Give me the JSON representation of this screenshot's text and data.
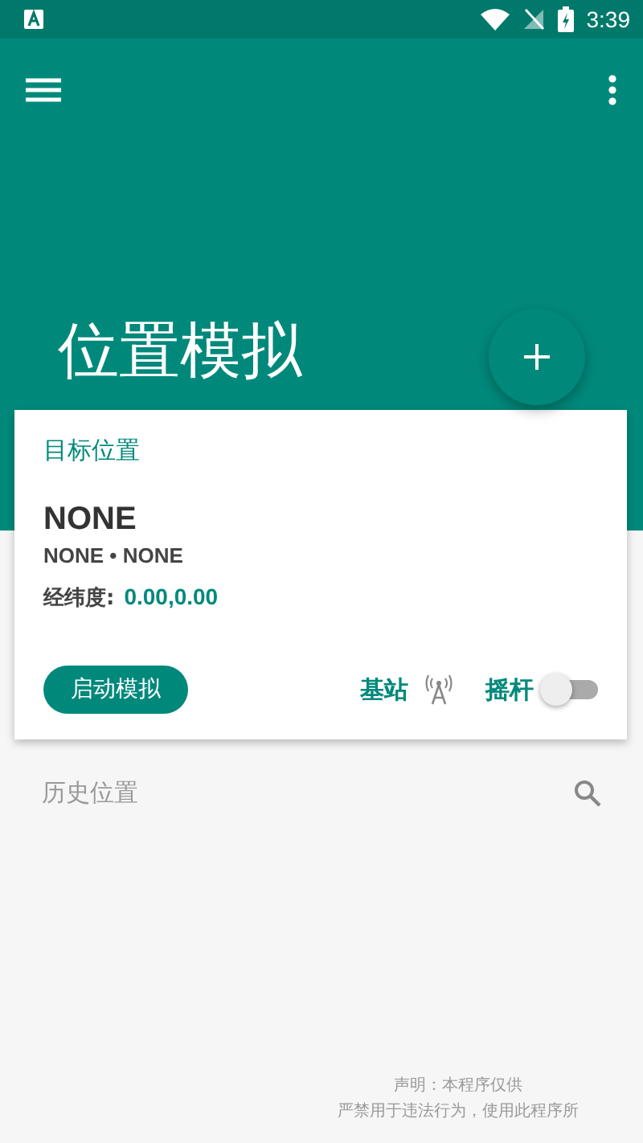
{
  "status_bar": {
    "time": "3:39"
  },
  "header": {
    "title": "位置模拟"
  },
  "target_card": {
    "heading": "目标位置",
    "name": "NONE",
    "region": "NONE • NONE",
    "coords_label": "经纬度:",
    "coords_value": "0.00,0.00",
    "start_button": "启动模拟",
    "base_station": {
      "label": "基站"
    },
    "joystick": {
      "label": "摇杆",
      "on": false
    }
  },
  "history": {
    "title": "历史位置"
  },
  "disclaimer": [
    "声明：本程序仅供",
    "严禁用于违法行为，使用此程序所"
  ]
}
